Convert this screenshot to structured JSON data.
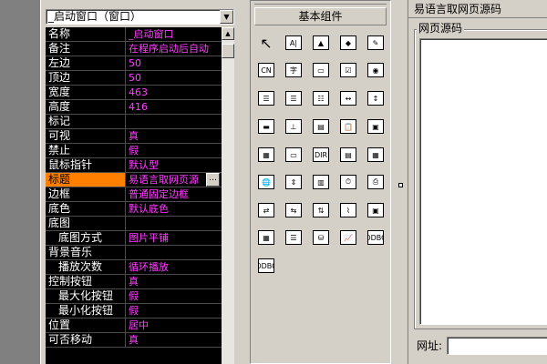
{
  "property_panel": {
    "object_selector": "_启动窗口（窗口）",
    "rows": [
      {
        "name": "名称",
        "value": "_启动窗口",
        "sub": false
      },
      {
        "name": "备注",
        "value": "在程序启动后自动",
        "sub": false
      },
      {
        "name": "左边",
        "value": "50",
        "sub": false
      },
      {
        "name": "顶边",
        "value": "50",
        "sub": false
      },
      {
        "name": "宽度",
        "value": "463",
        "sub": false
      },
      {
        "name": "高度",
        "value": "416",
        "sub": false
      },
      {
        "name": "标记",
        "value": "",
        "sub": false
      },
      {
        "name": "可视",
        "value": "真",
        "sub": false
      },
      {
        "name": "禁止",
        "value": "假",
        "sub": false
      },
      {
        "name": "鼠标指针",
        "value": "默认型",
        "sub": false
      },
      {
        "name": "标题",
        "value": "易语言取网页源",
        "sub": false,
        "selected": true,
        "ellipsis": "…"
      },
      {
        "name": "边框",
        "value": "普通固定边框",
        "sub": false
      },
      {
        "name": "底色",
        "value": "默认底色",
        "sub": false
      },
      {
        "name": "底图",
        "value": "",
        "sub": false
      },
      {
        "name": "底图方式",
        "value": "图片平铺",
        "sub": true
      },
      {
        "name": "背景音乐",
        "value": "",
        "sub": false
      },
      {
        "name": "播放次数",
        "value": "循环播放",
        "sub": true
      },
      {
        "name": "控制按钮",
        "value": "真",
        "sub": false
      },
      {
        "name": "最大化按钮",
        "value": "假",
        "sub": true
      },
      {
        "name": "最小化按钮",
        "value": "假",
        "sub": true
      },
      {
        "name": "位置",
        "value": "居中",
        "sub": false
      },
      {
        "name": "可否移动",
        "value": "真",
        "sub": false
      }
    ]
  },
  "components_panel": {
    "title": "基本组件",
    "icons": [
      {
        "name": "pointer-icon",
        "glyph": "↖"
      },
      {
        "name": "label-icon",
        "glyph": "A|"
      },
      {
        "name": "picture-box-icon",
        "glyph": "▲"
      },
      {
        "name": "shape-icon",
        "glyph": "◆"
      },
      {
        "name": "drawing-board-icon",
        "glyph": "✎"
      },
      {
        "name": "group-box-icon",
        "glyph": "CN"
      },
      {
        "name": "text-icon",
        "glyph": "字"
      },
      {
        "name": "button-icon",
        "glyph": "▭"
      },
      {
        "name": "checkbox-icon",
        "glyph": "☑"
      },
      {
        "name": "radio-icon",
        "glyph": "◉"
      },
      {
        "name": "combobox-icon",
        "glyph": "☰"
      },
      {
        "name": "listbox-icon",
        "glyph": "☰"
      },
      {
        "name": "select-listbox-icon",
        "glyph": "☷"
      },
      {
        "name": "hscroll-icon",
        "glyph": "↔"
      },
      {
        "name": "vscroll-icon",
        "glyph": "↕"
      },
      {
        "name": "progress-icon",
        "glyph": "▬"
      },
      {
        "name": "slider-icon",
        "glyph": "⊥"
      },
      {
        "name": "tab-icon",
        "glyph": "▤"
      },
      {
        "name": "clipboard-icon",
        "glyph": "📋"
      },
      {
        "name": "image-list-icon",
        "glyph": "▣"
      },
      {
        "name": "calendar-icon",
        "glyph": "▦"
      },
      {
        "name": "edit-box-icon",
        "glyph": "▭"
      },
      {
        "name": "dir-icon",
        "glyph": "DIR"
      },
      {
        "name": "file-box-icon",
        "glyph": "▤"
      },
      {
        "name": "color-picker-icon",
        "glyph": "▦"
      },
      {
        "name": "globe-icon",
        "glyph": "🌐"
      },
      {
        "name": "spinbox-icon",
        "glyph": "⇕"
      },
      {
        "name": "toolbar-icon",
        "glyph": "▥"
      },
      {
        "name": "timer-icon",
        "glyph": "⏱"
      },
      {
        "name": "printer-icon",
        "glyph": "⎙"
      },
      {
        "name": "network-icon",
        "glyph": "⇄"
      },
      {
        "name": "client-icon",
        "glyph": "⇆"
      },
      {
        "name": "server-icon",
        "glyph": "⇅"
      },
      {
        "name": "serial-icon",
        "glyph": "⌇"
      },
      {
        "name": "frame-icon",
        "glyph": "▣"
      },
      {
        "name": "db-grid-icon",
        "glyph": "▦"
      },
      {
        "name": "db-list-icon",
        "glyph": "☰"
      },
      {
        "name": "db-provider-icon",
        "glyph": "⛁"
      },
      {
        "name": "chart-icon",
        "glyph": "📈"
      },
      {
        "name": "odbc-db-icon",
        "glyph": "ODBC"
      },
      {
        "name": "odbc-source-icon",
        "glyph": "ODBC"
      }
    ]
  },
  "design_window": {
    "title": "易语言取网页源码",
    "group_label": "网页源码",
    "url_label": "网址:"
  }
}
